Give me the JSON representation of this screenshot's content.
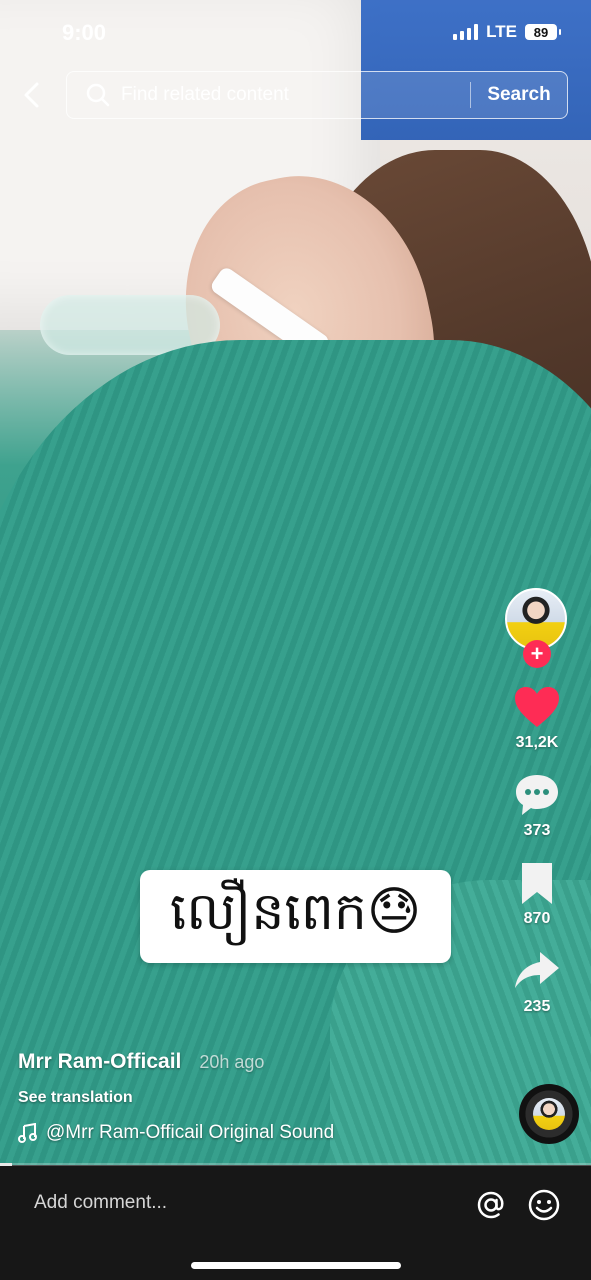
{
  "status_bar": {
    "time": "9:00",
    "network": "LTE",
    "battery": "89"
  },
  "search": {
    "placeholder": "Find related content",
    "button_label": "Search"
  },
  "sidebar": {
    "likes": "31,2K",
    "comments": "373",
    "bookmarks": "870",
    "shares": "235",
    "follow_symbol": "+"
  },
  "caption": {
    "text": "លឿនពេក😓"
  },
  "post": {
    "author": "Mrr Ram-Officail",
    "time_ago": "20h ago",
    "see_translation": "See translation",
    "sound": "@Mrr Ram-Officail Original Sound"
  },
  "progress": {
    "fraction": 0.02
  },
  "comment_bar": {
    "placeholder": "Add comment..."
  },
  "colors": {
    "like": "#fe2c55",
    "follow": "#fe2c55",
    "bar_bg": "#171717"
  }
}
